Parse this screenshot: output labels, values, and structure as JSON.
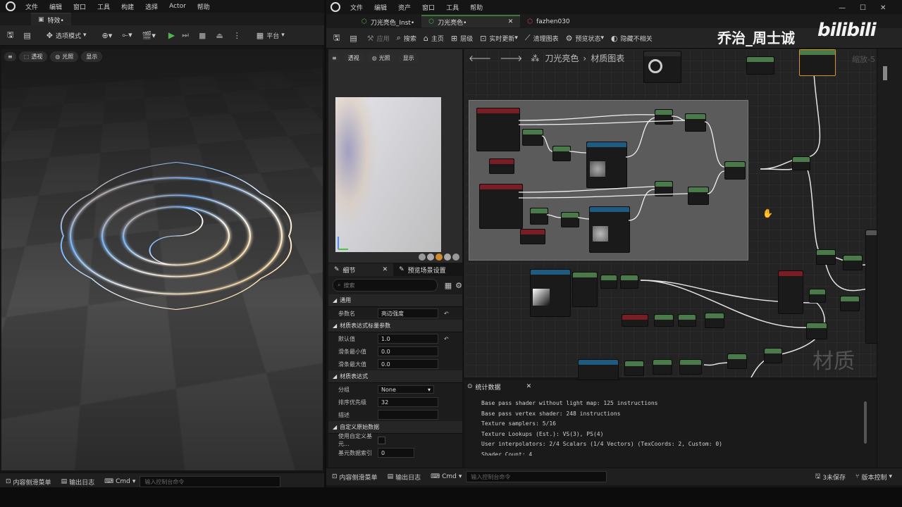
{
  "left_editor": {
    "menu": [
      "文件",
      "编辑",
      "窗口",
      "工具",
      "构建",
      "选择",
      "Actor",
      "帮助"
    ],
    "tab_label": "特效•",
    "toolbar": {
      "mode": "选项模式",
      "platform": "平台"
    },
    "viewport_pills": [
      "透视",
      "光照",
      "显示"
    ],
    "bottom": {
      "content_drawer": "内容侧滑菜单",
      "output_log": "输出日志",
      "cmd": "Cmd",
      "cmd_placeholder": "输入控制台命令"
    }
  },
  "right_editor": {
    "menu": [
      "文件",
      "编辑",
      "资产",
      "窗口",
      "工具",
      "帮助"
    ],
    "tabs": [
      "刀光亮色_Inst•",
      "刀光亮色•",
      "fazhen030"
    ],
    "toolbar": [
      "应用",
      "搜索",
      "主页",
      "层级",
      "实时更新",
      "清理图表",
      "预览状态",
      "隐藏不相关"
    ],
    "breadcrumb": {
      "asset": "刀光亮色",
      "section": "材质图表"
    },
    "zoom": "缩放-5",
    "preview_pills": [
      "透视",
      "光照",
      "显示"
    ],
    "details": {
      "tab_details": "细节",
      "tab_preview": "预览场景设置",
      "search_placeholder": "搜索",
      "sections": {
        "general": "通用",
        "scalar": "材质表达式标量参数",
        "expression": "材质表达式",
        "custom": "自定义原始数据"
      },
      "rows": {
        "param_name_label": "参数名",
        "param_name_value": "亮边强度",
        "default_label": "默认值",
        "default_value": "1.0",
        "slider_min_label": "滑条最小值",
        "slider_min_value": "0.0",
        "slider_max_label": "滑条最大值",
        "slider_max_value": "0.0",
        "group_label": "分组",
        "group_value": "None",
        "priority_label": "排序优先级",
        "priority_value": "32",
        "desc_label": "描述",
        "desc_value": "",
        "use_custom_label": "使用自定义基元...",
        "prim_index_label": "基元数据索引",
        "prim_index_value": "0"
      }
    },
    "stats": {
      "title": "统计数据",
      "lines": [
        "Base pass shader without light map: 125 instructions",
        "Base pass vertex shader: 248 instructions",
        "Texture samplers: 5/16",
        "Texture Lookups (Est.): VS(3), PS(4)",
        "User interpolators: 2/4 Scalars (1/4 Vectors) (TexCoords: 2, Custom: 0)",
        "Shader Count: 4"
      ]
    },
    "graph_watermark": "材质",
    "bottom": {
      "content_drawer": "内容侧滑菜单",
      "output_log": "输出日志",
      "cmd": "Cmd",
      "cmd_placeholder": "输入控制台命令",
      "unsaved": "3未保存",
      "source_control": "版本控制"
    }
  },
  "overlay": {
    "author": "乔治_周士诚",
    "brand": "bilibili"
  },
  "colors": {
    "param_header": "#7a1d24",
    "texture_header": "#1f5a80",
    "math_header": "#4a7a4a",
    "accent": "#6fa2ff"
  }
}
